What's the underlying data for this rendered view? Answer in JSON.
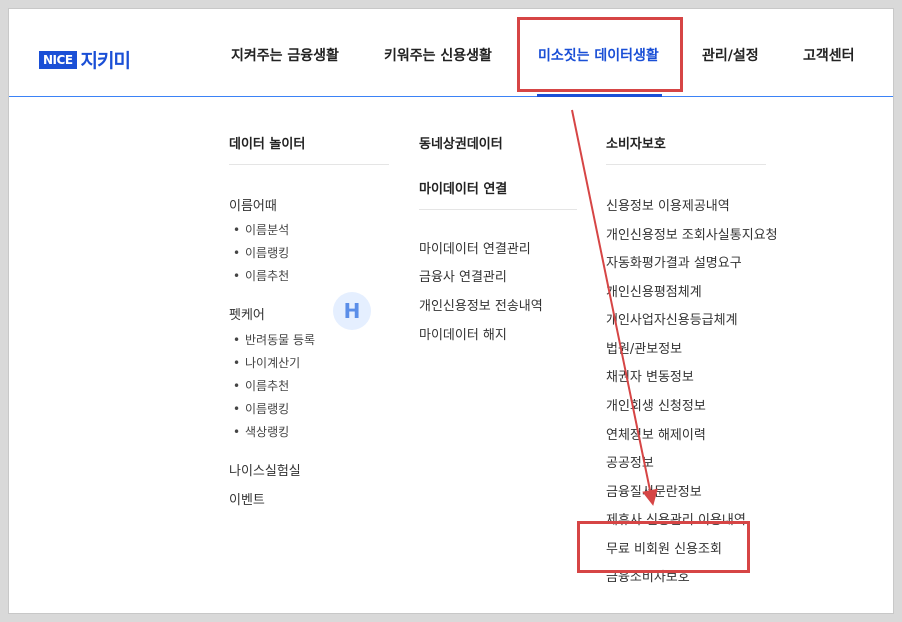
{
  "brand": {
    "badge": "NICE",
    "name": "지키미"
  },
  "nav": {
    "items": [
      "지켜주는 금융생활",
      "키워주는 신용생활",
      "미소짓는 데이터생활",
      "관리/설정",
      "고객센터"
    ],
    "active_index": 2
  },
  "menu": {
    "col1": {
      "title": "데이터 놀이터",
      "group1": {
        "label": "이름어때",
        "items": [
          "이름분석",
          "이름랭킹",
          "이름추천"
        ]
      },
      "group2": {
        "label": "펫케어",
        "items": [
          "반려동물 등록",
          "나이계산기",
          "이름추천",
          "이름랭킹",
          "색상랭킹"
        ]
      },
      "extra": [
        "나이스실험실",
        "이벤트"
      ]
    },
    "col2": {
      "title1": "동네상권데이터",
      "title2": "마이데이터 연결",
      "items": [
        "마이데이터 연결관리",
        "금융사 연결관리",
        "개인신용정보 전송내역",
        "마이데이터 해지"
      ]
    },
    "col3": {
      "title": "소비자보호",
      "items": [
        "신용정보 이용제공내역",
        "개인신용정보 조회사실통지요청",
        "자동화평가결과 설명요구",
        "개인신용평점체계",
        "개인사업자신용등급체계",
        "법원/관보정보",
        "채권자 변동정보",
        "개인회생 신청정보",
        "연체정보 해제이력",
        "공공정보",
        "금융질서문란정보",
        "제휴사 신용관리 이용내역",
        "무료 비회원 신용조회",
        "금융소비자보호"
      ]
    }
  },
  "watermark": "H",
  "colors": {
    "accent": "#1a4fd6",
    "highlight": "#d64545"
  }
}
